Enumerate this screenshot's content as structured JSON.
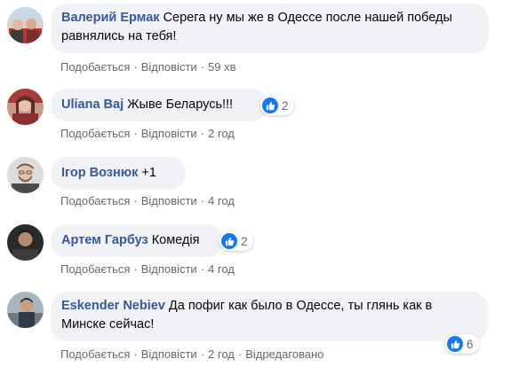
{
  "comments": [
    {
      "author": "Валерий Ермак",
      "text": "Серега ну мы же в Одессе после нашей победы равнялись на тебя!",
      "like_label": "Подобається",
      "reply_label": "Відповісти",
      "time": "59 хв",
      "reactions": ""
    },
    {
      "author": "Uliana Baj",
      "text": "Жыве Беларусь!!!",
      "like_label": "Подобається",
      "reply_label": "Відповісти",
      "time": "2 год",
      "reactions": "2"
    },
    {
      "author": "Ігор Вознюк",
      "text": "+1",
      "like_label": "Подобається",
      "reply_label": "Відповісти",
      "time": "4 год",
      "reactions": ""
    },
    {
      "author": "Артем Гарбуз",
      "text": "Комедія",
      "like_label": "Подобається",
      "reply_label": "Відповісти",
      "time": "4 год",
      "reactions": "2"
    },
    {
      "author": "Eskender Nebiev",
      "text": "Да пофиг как было в Одессе, ты глянь как в Минске сейчас!",
      "like_label": "Подобається",
      "reply_label": "Відповісти",
      "time": "2 год",
      "edited_label": "Відредаговано",
      "reactions": "6"
    }
  ],
  "colors": {
    "author": "#385898",
    "bubble": "#f0f2f5",
    "like": "#1877f2",
    "meta": "#65676b"
  }
}
